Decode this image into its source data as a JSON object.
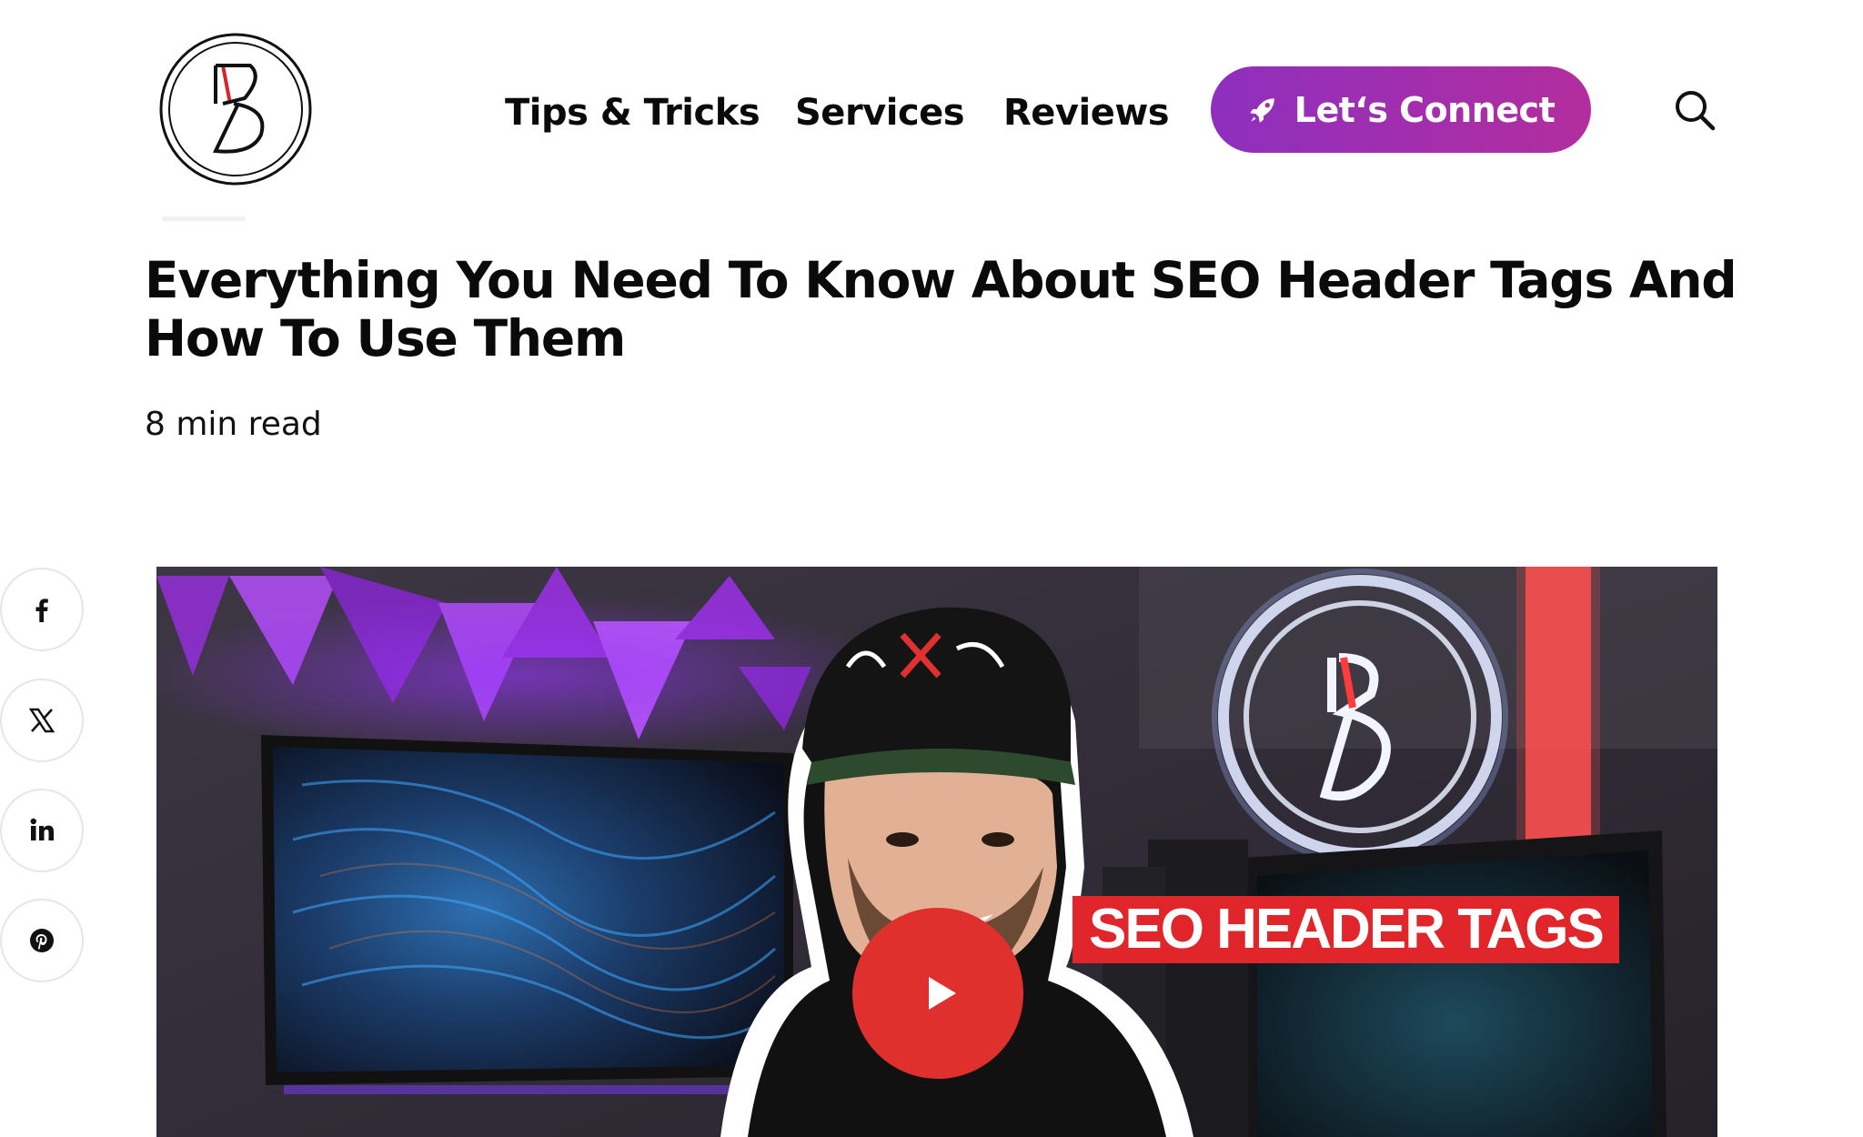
{
  "nav": {
    "items": [
      {
        "label": "Tips & Tricks"
      },
      {
        "label": "Services"
      },
      {
        "label": "Reviews"
      }
    ],
    "cta_label": "Let‘s Connect",
    "cta_icon": "rocket-icon",
    "search_icon": "search-icon"
  },
  "article": {
    "title": "Everything You Need To Know About SEO Header Tags And How To Use Them",
    "read_time": "8 min read"
  },
  "share": {
    "icons": [
      "facebook-icon",
      "x-icon",
      "linkedin-icon",
      "pinterest-icon"
    ]
  },
  "video": {
    "overlay_text": "SEO HEADER TAGS",
    "play_icon": "play-icon"
  },
  "colors": {
    "cta_gradient_start": "#8e2fbf",
    "cta_gradient_end": "#b32e9e",
    "play_button": "#e0302d",
    "overlay_label_bg": "#e0262b"
  }
}
